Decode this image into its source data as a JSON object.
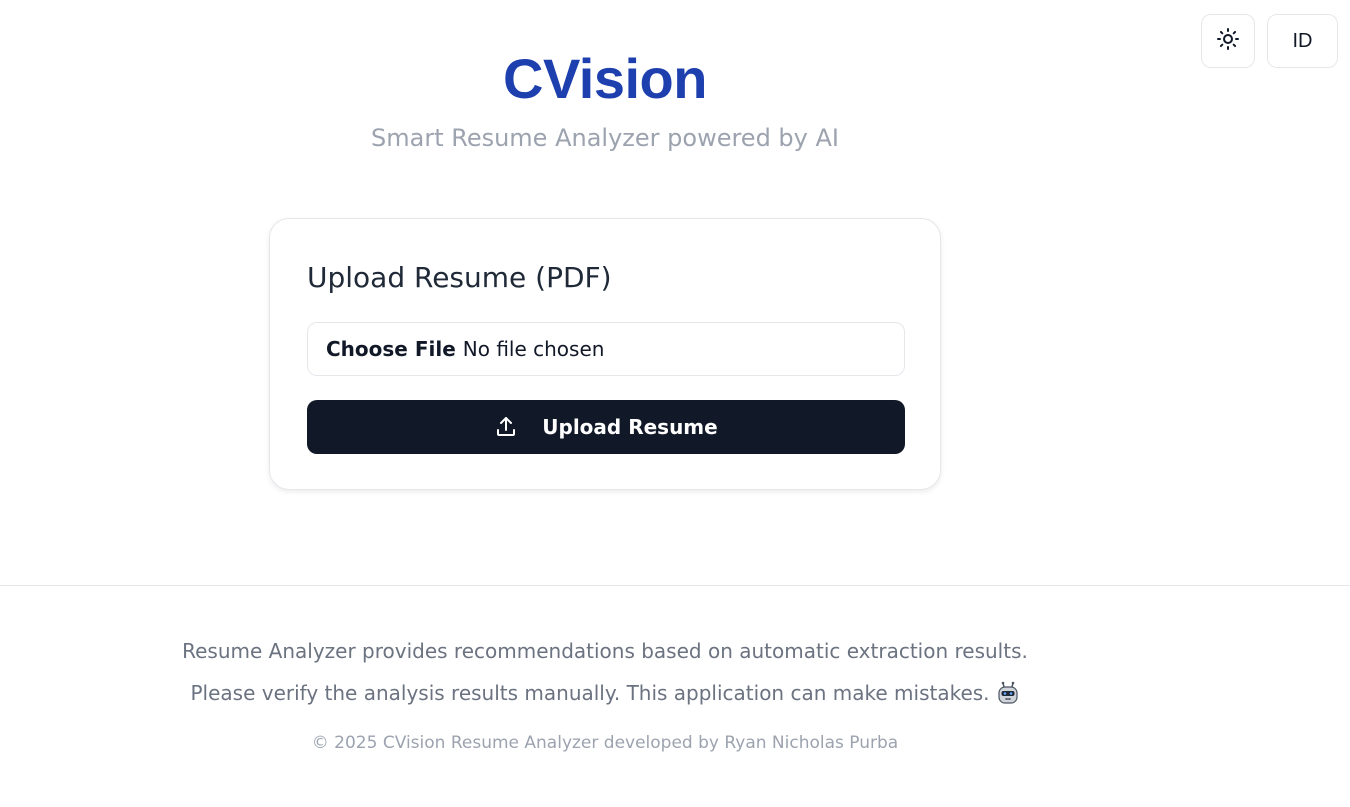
{
  "header": {
    "brand": "CVision",
    "tagline": "Smart Resume Analyzer powered by AI"
  },
  "controls": {
    "theme_icon": "sun-icon",
    "language_label": "ID"
  },
  "upload_card": {
    "title": "Upload Resume (PDF)",
    "file_button_label": "Choose File",
    "file_status": "No file chosen",
    "upload_icon": "upload-icon",
    "upload_button_label": "Upload Resume"
  },
  "footer": {
    "line1": "Resume Analyzer provides recommendations based on automatic extraction results.",
    "line2": "Please verify the analysis results manually. This application can make mistakes.",
    "line2_icon": "robot-icon",
    "copyright": "© 2025 CVision Resume Analyzer developed by Ryan Nicholas Purba"
  },
  "colors": {
    "brand": "#1e40af",
    "button_bg": "#111827"
  }
}
